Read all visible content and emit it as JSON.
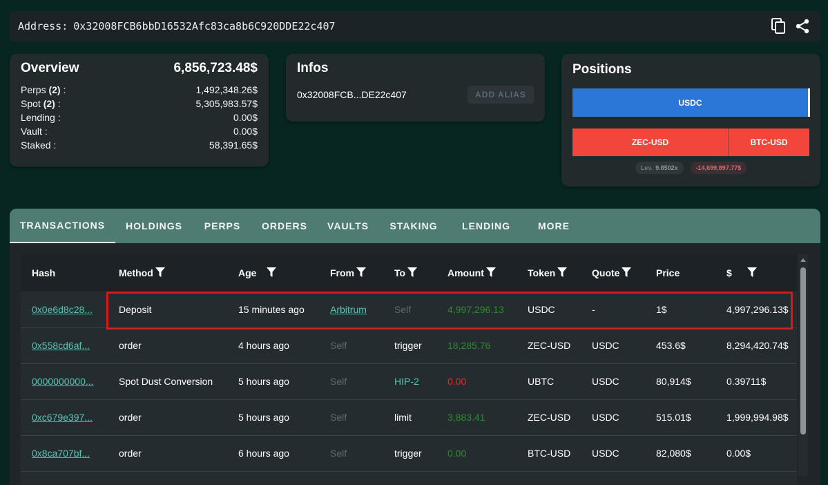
{
  "address_bar": {
    "label": "Address:",
    "value": "0x32008FCB6bbD16532Afc83ca8b6C920DDE22c407",
    "copy_icon": "copy-icon",
    "share_icon": "share-icon"
  },
  "overview": {
    "title": "Overview",
    "total": "6,856,723.48$",
    "rows": [
      {
        "label": "Perps",
        "count": "(2)",
        "suffix": " :",
        "value": "1,492,348.26$"
      },
      {
        "label": "Spot",
        "count": "(2)",
        "suffix": " :",
        "value": "5,305,983.57$"
      },
      {
        "label": "Lending :",
        "count": "",
        "suffix": "",
        "value": "0.00$"
      },
      {
        "label": "Vault :",
        "count": "",
        "suffix": "",
        "value": "0.00$"
      },
      {
        "label": "Staked :",
        "count": "",
        "suffix": "",
        "value": "58,391.65$"
      }
    ]
  },
  "infos": {
    "title": "Infos",
    "short_address": "0x32008FCB...DE22c407",
    "alias_button": "ADD ALIAS"
  },
  "positions": {
    "title": "Positions",
    "spot_bar": {
      "label": "USDC",
      "color": "#2b77d8",
      "share": 1.0
    },
    "perp_bars": [
      {
        "label": "ZEC-USD",
        "color": "#f2463d",
        "share": 0.66
      },
      {
        "label": "BTC-USD",
        "color": "#f2463d",
        "share": 0.34
      }
    ],
    "leverage_label": "Lev.",
    "leverage_value": "9.8502x",
    "pnl": "-14,699,897.77$"
  },
  "tabs": [
    {
      "label": "TRANSACTIONS",
      "active": true
    },
    {
      "label": "HOLDINGS",
      "active": false
    },
    {
      "label": "PERPS",
      "active": false
    },
    {
      "label": "ORDERS",
      "active": false
    },
    {
      "label": "VAULTS",
      "active": false
    },
    {
      "label": "STAKING",
      "active": false
    },
    {
      "label": "LENDING",
      "active": false
    },
    {
      "label": "MORE",
      "active": false
    }
  ],
  "table": {
    "columns": [
      "Hash",
      "Method",
      "Age",
      "From",
      "To",
      "Amount",
      "Token",
      "Quote",
      "Price",
      "$"
    ],
    "rows": [
      {
        "hash": "0x0e6d8c28...",
        "method": "Deposit",
        "age": "15 minutes ago",
        "from": "Arbitrum",
        "to": "Self",
        "amount": "4,997,296.13",
        "token": "USDC",
        "quote": "-",
        "price": "1$",
        "usd": "4,997,296.13$"
      },
      {
        "hash": "0x558cd6af...",
        "method": "order",
        "age": "4 hours ago",
        "from": "Self",
        "to": "trigger",
        "amount": "18,285.76",
        "token": "ZEC-USD",
        "quote": "USDC",
        "price": "453.6$",
        "usd": "8,294,420.74$"
      },
      {
        "hash": "0000000000...",
        "method": "Spot Dust Conversion",
        "age": "5 hours ago",
        "from": "Self",
        "to": "HIP-2",
        "amount": "0.00",
        "token": "UBTC",
        "quote": "USDC",
        "price": "80,914$",
        "usd": "0.39711$"
      },
      {
        "hash": "0xc679e397...",
        "method": "order",
        "age": "5 hours ago",
        "from": "Self",
        "to": "limit",
        "amount": "3,883.41",
        "token": "ZEC-USD",
        "quote": "USDC",
        "price": "515.01$",
        "usd": "1,999,994.98$"
      },
      {
        "hash": "0x8ca707bf...",
        "method": "order",
        "age": "6 hours ago",
        "from": "Self",
        "to": "trigger",
        "amount": "0.00",
        "token": "BTC-USD",
        "quote": "USDC",
        "price": "82,080$",
        "usd": "0.00$"
      }
    ]
  },
  "colors": {
    "background": "#072621",
    "card": "#232a2c",
    "tab_bar": "#4f7c72",
    "link": "#59c5b4",
    "amount_positive": "#2a8c2d",
    "amount_negative": "#e12b2b",
    "highlight_box": "#d21b1b"
  }
}
